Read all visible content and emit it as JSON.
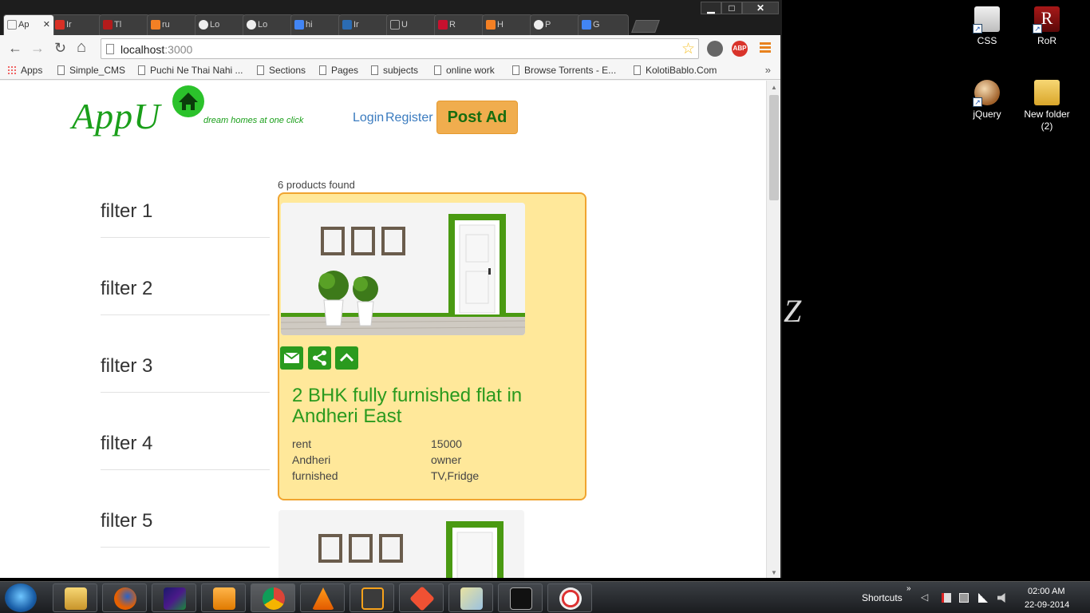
{
  "window": {
    "minimize_label": "▁",
    "maximize_label": "□",
    "close_label": "✕"
  },
  "tabs": [
    {
      "label": "Ap",
      "active": true,
      "color": "#ffffff"
    },
    {
      "label": "Ir",
      "color": "#d93025"
    },
    {
      "label": "Tl",
      "color": "#b31b1b"
    },
    {
      "label": "ru",
      "color": "#f48024"
    },
    {
      "label": "Lo",
      "color": "#222222"
    },
    {
      "label": "Lo",
      "color": "#222222"
    },
    {
      "label": "hi",
      "color": "#4285f4"
    },
    {
      "label": "Ir",
      "color": "#2b6cb3"
    },
    {
      "label": "U",
      "color": "#ffffff"
    },
    {
      "label": "R",
      "color": "#c8102e"
    },
    {
      "label": "H",
      "color": "#f48024"
    },
    {
      "label": "P",
      "color": "#222222"
    },
    {
      "label": "G",
      "color": "#4285f4"
    }
  ],
  "tab_close_label": "✕",
  "toolbar": {
    "back": "←",
    "forward": "→",
    "reload": "↻",
    "home": "⌂",
    "url_host": "localhost",
    "url_port": ":3000",
    "star": "☆",
    "abp_label": "ABP"
  },
  "bookmarks": {
    "apps": "Apps",
    "items": [
      "Simple_CMS",
      "Puchi Ne Thai Nahi ...",
      "Sections",
      "Pages",
      "subjects",
      "online work",
      "Browse Torrents - E...",
      "KolotiBablo.Com"
    ],
    "more": "»"
  },
  "site": {
    "logo_text": "AppU",
    "tagline": "dream homes at one click",
    "login": "Login",
    "register": "Register",
    "post_ad": "Post Ad",
    "brand_green": "#1a9f1a",
    "button_orange": "#f0ad4e"
  },
  "filters": [
    "filter 1",
    "filter 2",
    "filter 3",
    "filter 4",
    "filter 5"
  ],
  "results": {
    "count_text": "6 products found"
  },
  "listing": {
    "title": "2 BHK fully furnished flat in Andheri East",
    "type": "rent",
    "price": "15000",
    "location": "Andheri",
    "posted_by": "owner",
    "furnishing": "furnished",
    "amenities": "TV,Fridge",
    "actions": [
      "email-icon",
      "share-icon",
      "chevron-up-icon"
    ]
  },
  "desktop": {
    "icons": [
      {
        "label": "CSS",
        "name": "css-shortcut"
      },
      {
        "label": "RoR",
        "name": "ror-shortcut"
      },
      {
        "label": "jQuery",
        "name": "jquery-shortcut"
      },
      {
        "label": "New folder (2)",
        "name": "new-folder"
      }
    ],
    "watermark": "Z"
  },
  "taskbar": {
    "shortcuts_label": "Shortcuts",
    "chevron": "»",
    "tray_arrow": "◁",
    "time": "02:00 AM",
    "date": "22-09-2014",
    "apps": [
      "explorer",
      "firefox",
      "winamp",
      "media-player",
      "chrome",
      "vlc",
      "sublime-text",
      "git",
      "file-manager",
      "cmd",
      "snipping-tool"
    ]
  }
}
